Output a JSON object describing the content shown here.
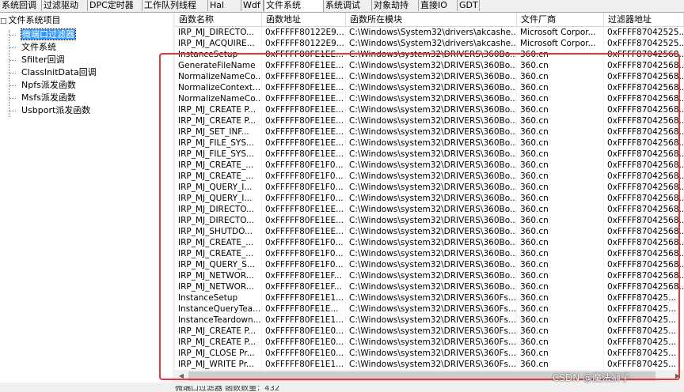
{
  "tabs": [
    {
      "label": "系统回调",
      "active": false
    },
    {
      "label": "过滤驱动",
      "active": false
    },
    {
      "label": "DPC定时器",
      "active": false
    },
    {
      "label": "工作队列线程",
      "active": false
    },
    {
      "label": "Hal",
      "active": false
    },
    {
      "label": "Wdf",
      "active": false
    },
    {
      "label": "文件系统",
      "active": true
    },
    {
      "label": "系统调试",
      "active": false
    },
    {
      "label": "对象劫持",
      "active": false
    },
    {
      "label": "直接IO",
      "active": false
    },
    {
      "label": "GDT",
      "active": false
    }
  ],
  "tree": {
    "expander": "□",
    "root": "文件系统项目",
    "children": [
      {
        "label": "微端口过滤器",
        "selected": true
      },
      {
        "label": "文件系统",
        "selected": false
      },
      {
        "label": "Sfilter回调",
        "selected": false
      },
      {
        "label": "ClassInitData回调",
        "selected": false
      },
      {
        "label": "Npfs派发函数",
        "selected": false
      },
      {
        "label": "Msfs派发函数",
        "selected": false
      },
      {
        "label": "Usbport派发函数",
        "selected": false
      }
    ]
  },
  "columns": [
    "函数名称",
    "函数地址",
    "函数所在模块",
    "文件厂商",
    "过滤器地址"
  ],
  "rows": [
    [
      "IRP_MJ_DIRECTO...",
      "0xFFFFF80122E9...",
      "C:\\Windows\\System32\\drivers\\akcashe...",
      "Microsoft Corpor...",
      "0xFFFF87042525..."
    ],
    [
      "IRP_MJ_ACQUIRE...",
      "0xFFFFF80122E9...",
      "C:\\Windows\\System32\\drivers\\akcashe...",
      "Microsoft Corpor...",
      "0xFFFF87042525..."
    ],
    [
      "InstanceSetup",
      "0xFFFFF80FE1EE...",
      "C:\\Windows\\system32\\DRIVERS\\360Bo...",
      "360.cn",
      "0xFFFF87042568..."
    ],
    [
      "GenerateFileName",
      "0xFFFFF80FE1EE...",
      "C:\\Windows\\system32\\DRIVERS\\360Bo...",
      "360.cn",
      "0xFFFF87042568..."
    ],
    [
      "NormalizeNameCo...",
      "0xFFFFF80FE1EE...",
      "C:\\Windows\\system32\\DRIVERS\\360Bo...",
      "360.cn",
      "0xFFFF87042568..."
    ],
    [
      "NormalizeContext...",
      "0xFFFFF80FE1EE...",
      "C:\\Windows\\system32\\DRIVERS\\360Bo...",
      "360.cn",
      "0xFFFF87042568..."
    ],
    [
      "NormalizeNameCo...",
      "0xFFFFF80FE1EE...",
      "C:\\Windows\\system32\\DRIVERS\\360Bo...",
      "360.cn",
      "0xFFFF87042568..."
    ],
    [
      "IRP_MJ_CREATE P...",
      "0xFFFFF80FE1EE...",
      "C:\\Windows\\system32\\DRIVERS\\360Bo...",
      "360.cn",
      "0xFFFF87042568..."
    ],
    [
      "IRP_MJ_CREATE P...",
      "0xFFFFF80FE1EE...",
      "C:\\Windows\\system32\\DRIVERS\\360Bo...",
      "360.cn",
      "0xFFFF87042568..."
    ],
    [
      "IRP_MJ_SET_INF...",
      "0xFFFFF80FE1EE...",
      "C:\\Windows\\system32\\DRIVERS\\360Bo...",
      "360.cn",
      "0xFFFF87042568..."
    ],
    [
      "IRP_MJ_FILE_SYS...",
      "0xFFFFF80FE1EE...",
      "C:\\Windows\\system32\\DRIVERS\\360Bo...",
      "360.cn",
      "0xFFFF87042568..."
    ],
    [
      "IRP_MJ_FILE_SYS...",
      "0xFFFFF80FE1EE...",
      "C:\\Windows\\system32\\DRIVERS\\360Bo...",
      "360.cn",
      "0xFFFF87042568..."
    ],
    [
      "IRP_MJ_CREATE_...",
      "0xFFFFF80FE1F0...",
      "C:\\Windows\\system32\\DRIVERS\\360Bo...",
      "360.cn",
      "0xFFFF87042568..."
    ],
    [
      "IRP_MJ_CREATE_...",
      "0xFFFFF80FE1F0...",
      "C:\\Windows\\system32\\DRIVERS\\360Bo...",
      "360.cn",
      "0xFFFF87042568..."
    ],
    [
      "IRP_MJ_QUERY_I...",
      "0xFFFFF80FE1F0...",
      "C:\\Windows\\system32\\DRIVERS\\360Bo...",
      "360.cn",
      "0xFFFF87042568..."
    ],
    [
      "IRP_MJ_QUERY_I...",
      "0xFFFFF80FE1F0...",
      "C:\\Windows\\system32\\DRIVERS\\360Bo...",
      "360.cn",
      "0xFFFF87042568..."
    ],
    [
      "IRP_MJ_DIRECTO...",
      "0xFFFFF80FE1EE...",
      "C:\\Windows\\system32\\DRIVERS\\360Bo...",
      "360.cn",
      "0xFFFF87042568..."
    ],
    [
      "IRP_MJ_DIRECTO...",
      "0xFFFFF80FE1EE...",
      "C:\\Windows\\system32\\DRIVERS\\360Bo...",
      "360.cn",
      "0xFFFF87042568..."
    ],
    [
      "IRP_MJ_SHUTDO...",
      "0xFFFFF80FE1EE...",
      "C:\\Windows\\system32\\DRIVERS\\360Bo...",
      "360.cn",
      "0xFFFF87042568..."
    ],
    [
      "IRP_MJ_CREATE_...",
      "0xFFFFF80FE1F0...",
      "C:\\Windows\\system32\\DRIVERS\\360Bo...",
      "360.cn",
      "0xFFFF87042568..."
    ],
    [
      "IRP_MJ_CREATE_...",
      "0xFFFFF80FE1F0...",
      "C:\\Windows\\system32\\DRIVERS\\360Bo...",
      "360.cn",
      "0xFFFF87042568..."
    ],
    [
      "IRP_MJ_QUERY_S...",
      "0xFFFFF80FE1F0...",
      "C:\\Windows\\system32\\DRIVERS\\360Bo...",
      "360.cn",
      "0xFFFF87042568..."
    ],
    [
      "IRP_MJ_NETWOR...",
      "0xFFFFF80FE1EF...",
      "C:\\Windows\\system32\\DRIVERS\\360Bo...",
      "360.cn",
      "0xFFFF87042568..."
    ],
    [
      "IRP_MJ_NETWOR...",
      "0xFFFFF80FE1EF...",
      "C:\\Windows\\system32\\DRIVERS\\360Bo...",
      "360.cn",
      "0xFFFF87042568..."
    ],
    [
      "InstanceSetup",
      "0xFFFFF80FE1E1...",
      "C:\\Windows\\system32\\DRIVERS\\360Fs...",
      "360.cn",
      "0xFFFF870425..."
    ],
    [
      "InstanceQueryTea...",
      "0xFFFFF80FE1E...",
      "C:\\Windows\\system32\\DRIVERS\\360Fs...",
      "360.cn",
      "0xFFFF870425..."
    ],
    [
      "InstanceTeardown...",
      "0xFFFFF80FE1E1...",
      "C:\\Windows\\system32\\DRIVERS\\360Fs...",
      "360.cn",
      "0xFFFF870425..."
    ],
    [
      "IRP_MJ_CREATE P...",
      "0xFFFFF80FE1E0...",
      "C:\\Windows\\system32\\DRIVERS\\360Fs...",
      "360.cn",
      "0xFFFF870425..."
    ],
    [
      "IRP_MJ_CREATE P...",
      "0xFFFFF80FE1E0...",
      "C:\\Windows\\system32\\DRIVERS\\360Fs...",
      "360.cn",
      "0xFFFF870425..."
    ],
    [
      "IRP_MJ_CLOSE Pr...",
      "0xFFFFF80FE1E0...",
      "C:\\Windows\\system32\\DRIVERS\\360Fs...",
      "360.cn",
      "0xFFFF870425..."
    ],
    [
      "IRP_MJ_WRITE Pr...",
      "0xFFFFF80FE1E1...",
      "C:\\Windows\\system32\\DRIVERS\\360Fs...",
      "360.cn",
      "0xFFFF870425..."
    ]
  ],
  "status_text": "微端口过滤器 函数数量：432",
  "watermark": "CSDN @魔法狮子",
  "colors": {
    "highlight": "#e53935",
    "selection": "#3399ff"
  }
}
